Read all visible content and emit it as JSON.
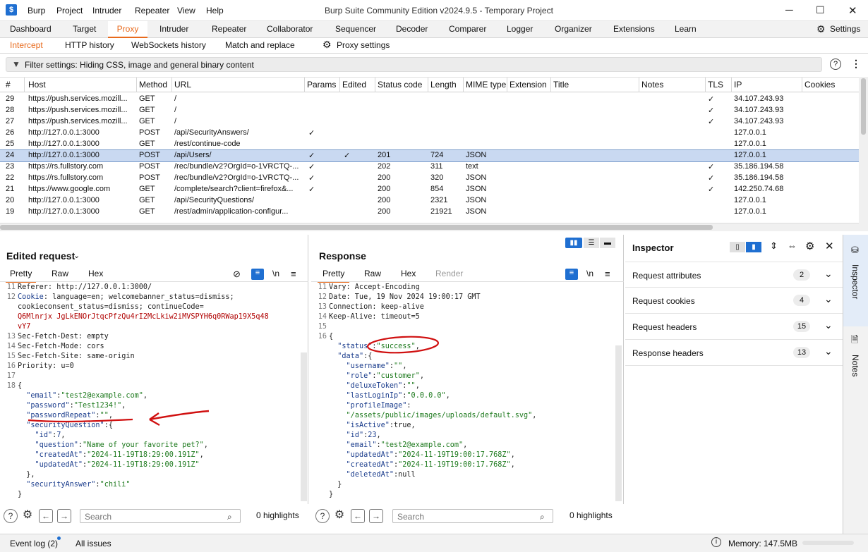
{
  "app": {
    "logo": "burp-logo-icon",
    "window_title": "Burp Suite Community Edition v2024.9.5 - Temporary Project",
    "menu": [
      "Burp",
      "Project",
      "Intruder",
      "Repeater",
      "View",
      "Help"
    ]
  },
  "main_tabs": [
    "Dashboard",
    "Target",
    "Proxy",
    "Intruder",
    "Repeater",
    "Collaborator",
    "Sequencer",
    "Decoder",
    "Comparer",
    "Logger",
    "Organizer",
    "Extensions",
    "Learn"
  ],
  "settings_label": "Settings",
  "sub_tabs": [
    "Intercept",
    "HTTP history",
    "WebSockets history",
    "Match and replace"
  ],
  "proxy_settings_label": "Proxy settings",
  "filter_text": "Filter settings: Hiding CSS, image and general binary content",
  "history": {
    "columns": [
      "#",
      "Host",
      "Method",
      "URL",
      "Params",
      "Edited",
      "Status code",
      "Length",
      "MIME type",
      "Extension",
      "Title",
      "Notes",
      "TLS",
      "IP",
      "Cookies"
    ],
    "rows": [
      {
        "num": "29",
        "host": "https://push.services.mozill...",
        "method": "GET",
        "url": "/",
        "params": "",
        "edited": "",
        "status": "",
        "length": "",
        "mime": "",
        "tls": "✓",
        "ip": "34.107.243.93"
      },
      {
        "num": "28",
        "host": "https://push.services.mozill...",
        "method": "GET",
        "url": "/",
        "params": "",
        "edited": "",
        "status": "",
        "length": "",
        "mime": "",
        "tls": "✓",
        "ip": "34.107.243.93"
      },
      {
        "num": "27",
        "host": "https://push.services.mozill...",
        "method": "GET",
        "url": "/",
        "params": "",
        "edited": "",
        "status": "",
        "length": "",
        "mime": "",
        "tls": "✓",
        "ip": "34.107.243.93"
      },
      {
        "num": "26",
        "host": "http://127.0.0.1:3000",
        "method": "POST",
        "url": "/api/SecurityAnswers/",
        "params": "✓",
        "edited": "",
        "status": "",
        "length": "",
        "mime": "",
        "tls": "",
        "ip": "127.0.0.1"
      },
      {
        "num": "25",
        "host": "http://127.0.0.1:3000",
        "method": "GET",
        "url": "/rest/continue-code",
        "params": "",
        "edited": "",
        "status": "",
        "length": "",
        "mime": "",
        "tls": "",
        "ip": "127.0.0.1"
      },
      {
        "num": "24",
        "host": "http://127.0.0.1:3000",
        "method": "POST",
        "url": "/api/Users/",
        "params": "✓",
        "edited": "✓",
        "status": "201",
        "length": "724",
        "mime": "JSON",
        "tls": "",
        "ip": "127.0.0.1",
        "selected": true
      },
      {
        "num": "23",
        "host": "https://rs.fullstory.com",
        "method": "POST",
        "url": "/rec/bundle/v2?OrgId=o-1VRCTQ-...",
        "params": "✓",
        "edited": "",
        "status": "202",
        "length": "311",
        "mime": "text",
        "tls": "✓",
        "ip": "35.186.194.58"
      },
      {
        "num": "22",
        "host": "https://rs.fullstory.com",
        "method": "POST",
        "url": "/rec/bundle/v2?OrgId=o-1VRCTQ-...",
        "params": "✓",
        "edited": "",
        "status": "200",
        "length": "320",
        "mime": "JSON",
        "tls": "✓",
        "ip": "35.186.194.58"
      },
      {
        "num": "21",
        "host": "https://www.google.com",
        "method": "GET",
        "url": "/complete/search?client=firefox&...",
        "params": "✓",
        "edited": "",
        "status": "200",
        "length": "854",
        "mime": "JSON",
        "tls": "✓",
        "ip": "142.250.74.68"
      },
      {
        "num": "20",
        "host": "http://127.0.0.1:3000",
        "method": "GET",
        "url": "/api/SecurityQuestions/",
        "params": "",
        "edited": "",
        "status": "200",
        "length": "2321",
        "mime": "JSON",
        "tls": "",
        "ip": "127.0.0.1"
      },
      {
        "num": "19",
        "host": "http://127.0.0.1:3000",
        "method": "GET",
        "url": "/rest/admin/application-configur...",
        "params": "",
        "edited": "",
        "status": "200",
        "length": "21921",
        "mime": "JSON",
        "tls": "",
        "ip": "127.0.0.1"
      }
    ]
  },
  "request": {
    "title": "Edited request",
    "tabs": [
      "Pretty",
      "Raw",
      "Hex"
    ],
    "newline_label": "\\n",
    "search_placeholder": "Search",
    "highlights": "0 highlights"
  },
  "response": {
    "title": "Response",
    "tabs": [
      "Pretty",
      "Raw",
      "Hex",
      "Render"
    ],
    "newline_label": "\\n",
    "search_placeholder": "Search",
    "highlights": "0 highlights"
  },
  "inspector": {
    "title": "Inspector",
    "sections": [
      {
        "label": "Request attributes",
        "count": "2"
      },
      {
        "label": "Request cookies",
        "count": "4"
      },
      {
        "label": "Request headers",
        "count": "15"
      },
      {
        "label": "Response headers",
        "count": "13"
      }
    ]
  },
  "side_tabs": [
    "Inspector",
    "Notes"
  ],
  "statusbar": {
    "event_log": "Event log (2)",
    "all_issues": "All issues",
    "memory": "Memory: 147.5MB"
  },
  "colors": {
    "accent": "#e86a1c",
    "selection": "#c9d9f1",
    "annotation": "#d01010",
    "logo": "#1f6fd1"
  }
}
